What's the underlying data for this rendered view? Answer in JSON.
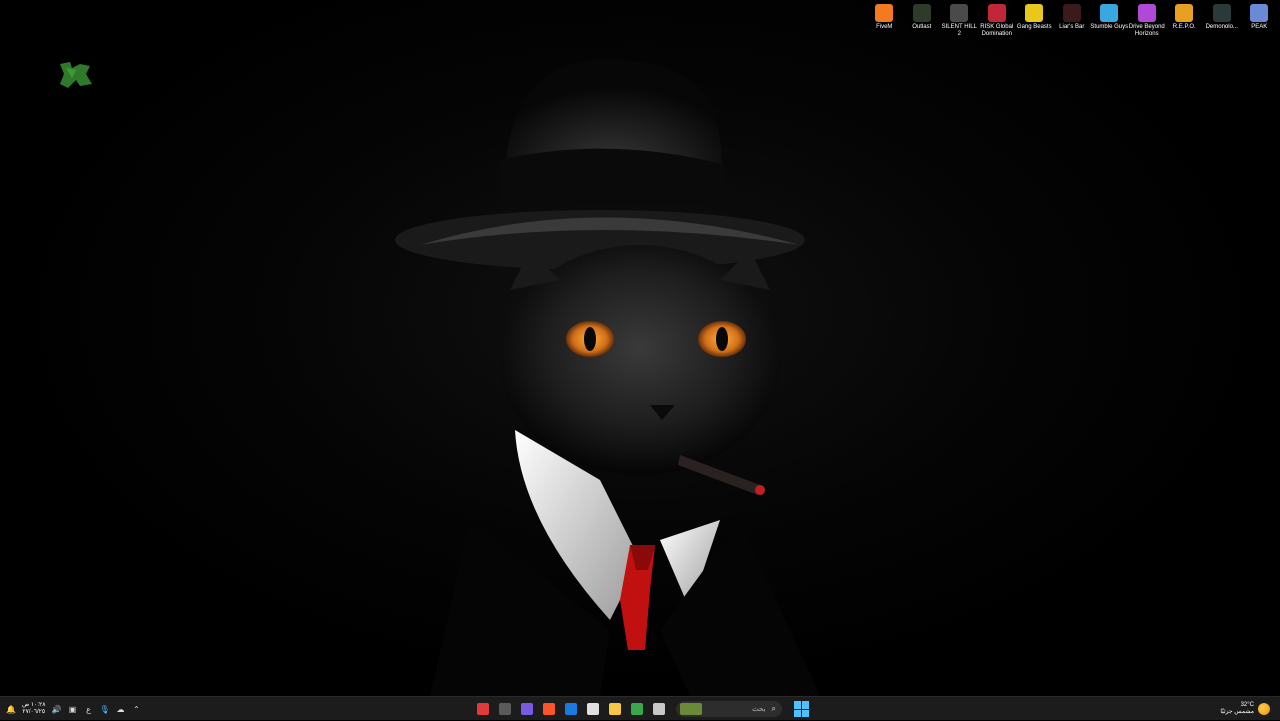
{
  "desktop_icons": [
    {
      "label": "FiveM",
      "icon": "fivem-icon",
      "color": "#f47a20"
    },
    {
      "label": "Outlast",
      "icon": "outlast-icon",
      "color": "#2e3a2a"
    },
    {
      "label": "SILENT HILL 2",
      "icon": "silent-hill-icon",
      "color": "#4a4a4a"
    },
    {
      "label": "RISK Global Domination",
      "icon": "risk-icon",
      "color": "#c0283a"
    },
    {
      "label": "Gang Beasts",
      "icon": "gang-beasts-icon",
      "color": "#e8c81a"
    },
    {
      "label": "Liar's Bar",
      "icon": "liars-bar-icon",
      "color": "#3a1a1a"
    },
    {
      "label": "Stumble Guys",
      "icon": "stumble-guys-icon",
      "color": "#3aa8e0"
    },
    {
      "label": "Drive Beyond Horizons",
      "icon": "drive-beyond-icon",
      "color": "#b048d8"
    },
    {
      "label": "R.E.P.O.",
      "icon": "repo-icon",
      "color": "#e8a020"
    },
    {
      "label": "Demonolo...",
      "icon": "demonologist-icon",
      "color": "#2a3a3a"
    },
    {
      "label": "PEAK",
      "icon": "peak-icon",
      "color": "#6a8ad8"
    }
  ],
  "taskbar": {
    "search_placeholder": "بحث",
    "apps": [
      {
        "name": "security-app",
        "color": "#e03a3a"
      },
      {
        "name": "xbox-app",
        "color": "#5a5a5a"
      },
      {
        "name": "chat-app",
        "color": "#7a5ae0"
      },
      {
        "name": "brave-app",
        "color": "#fb542b"
      },
      {
        "name": "outlook-app",
        "color": "#1a7ae0"
      },
      {
        "name": "calendar-app",
        "color": "#e0e0e0"
      },
      {
        "name": "file-explorer-app",
        "color": "#f6c744"
      },
      {
        "name": "chrome-app",
        "color": "#3aa84a"
      },
      {
        "name": "notes-app",
        "color": "#c8c8c8"
      }
    ]
  },
  "tray": {
    "time": "١٠:٢٨ ص",
    "date": "٢٧/٠٦/٢٥",
    "language": "ع"
  },
  "weather": {
    "temp": "32°C",
    "condition": "مشمس جزئيًا"
  }
}
